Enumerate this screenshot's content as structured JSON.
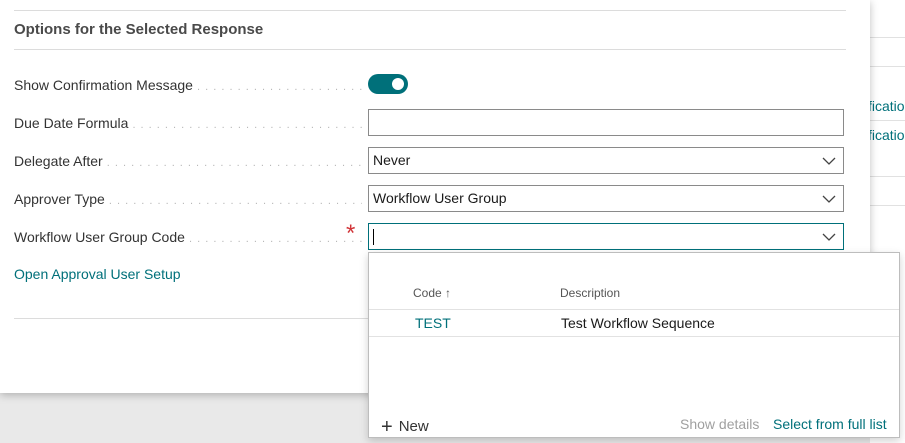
{
  "background": {
    "links": [
      "fication",
      "fication"
    ]
  },
  "dialog": {
    "section_title": "Options for the Selected Response",
    "fields": {
      "show_confirmation": {
        "label": "Show Confirmation Message",
        "value": true
      },
      "due_date_formula": {
        "label": "Due Date Formula",
        "value": ""
      },
      "delegate_after": {
        "label": "Delegate After",
        "value": "Never"
      },
      "approver_type": {
        "label": "Approver Type",
        "value": "Workflow User Group"
      },
      "workflow_user_group_code": {
        "label": "Workflow User Group Code",
        "value": "",
        "required_mark": "*"
      }
    },
    "link": "Open Approval User Setup"
  },
  "dropdown": {
    "columns": {
      "code": "Code ↑",
      "description": "Description"
    },
    "rows": [
      {
        "code": "TEST",
        "description": "Test Workflow Sequence"
      }
    ],
    "footer": {
      "new_plus": "+",
      "new": "New",
      "show_details": "Show details",
      "select_full": "Select from full list"
    }
  },
  "colors": {
    "accent": "#00707a",
    "required": "#d13438"
  }
}
